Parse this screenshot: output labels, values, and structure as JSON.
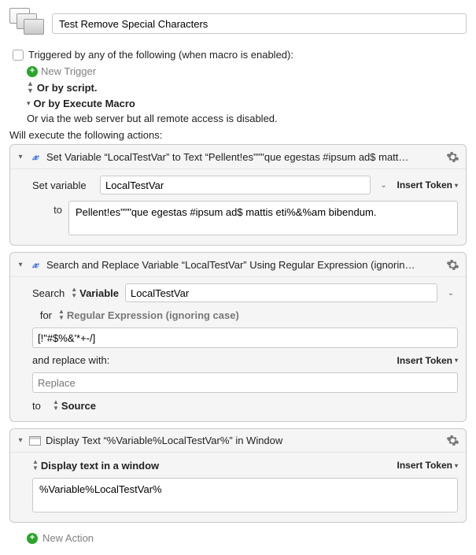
{
  "title_value": "Test Remove Special Characters",
  "trigger_section": {
    "header": "Triggered by any of the following (when macro is enabled):",
    "new_trigger": "New Trigger",
    "or_script": "Or by script.",
    "or_execute": "Or by Execute Macro",
    "or_web": "Or via the web server but all remote access is disabled."
  },
  "exec_label": "Will execute the following actions:",
  "action_set_var": {
    "title": "Set Variable “LocalTestVar” to Text “Pellent!es\"\"\"que egestas #ipsum ad$ matt…",
    "set_variable_label": "Set variable",
    "var_name": "LocalTestVar",
    "insert_token": "Insert Token",
    "to_label": "to",
    "to_value": "Pellent!es\"\"\"que egestas #ipsum ad$ mattis eti%&%am bibendum."
  },
  "action_search_replace": {
    "title": "Search and Replace Variable “LocalTestVar” Using Regular Expression (ignorin…",
    "search_label": "Search",
    "variable_label": "Variable",
    "var_name": "LocalTestVar",
    "for_label": "for",
    "regex_label": "Regular Expression (ignoring case)",
    "pattern": "[!\"#$%&'*+-/]",
    "replace_label": "and replace with:",
    "insert_token": "Insert Token",
    "replace_placeholder": "Replace",
    "to_label": "to",
    "source_label": "Source"
  },
  "action_display": {
    "title": "Display Text “%Variable%LocalTestVar%” in Window",
    "display_label": "Display text in a window",
    "insert_token": "Insert Token",
    "text_value": "%Variable%LocalTestVar%"
  },
  "new_action": "New Action"
}
